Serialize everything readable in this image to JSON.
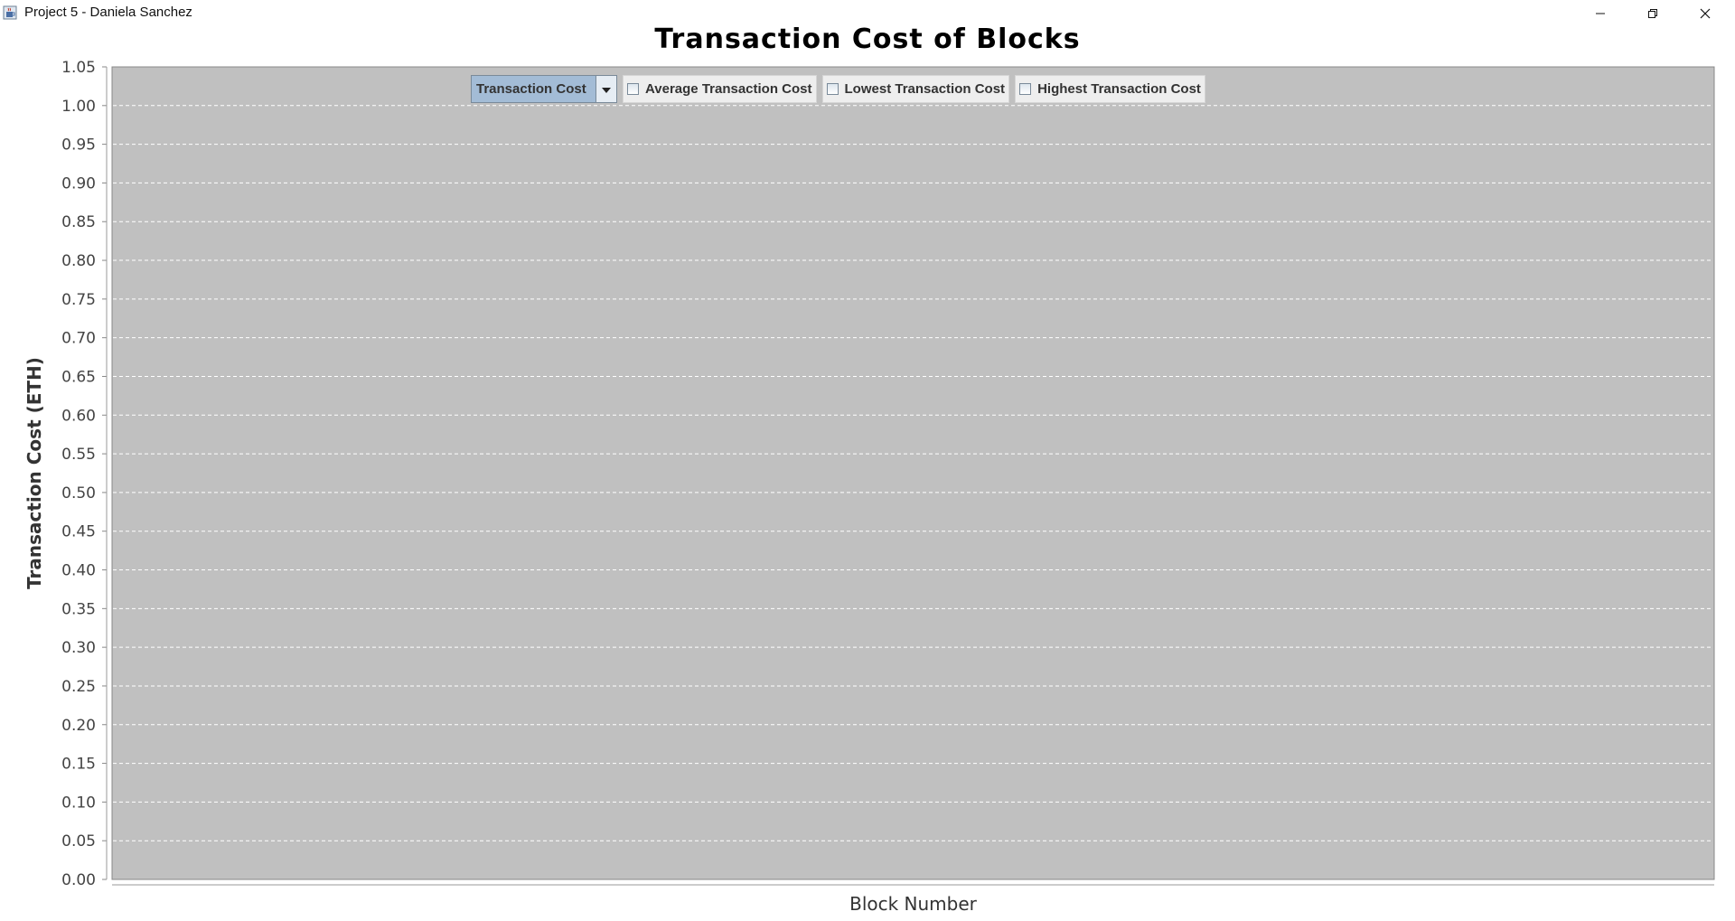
{
  "window": {
    "title": "Project 5 - Daniela Sanchez",
    "icon": "java-cup-icon",
    "controls": [
      "minimize-icon",
      "restore-icon",
      "close-icon"
    ]
  },
  "controls": {
    "series_select": {
      "selected": "Transaction Cost"
    },
    "checkboxes": [
      {
        "label": "Average Transaction Cost",
        "checked": false
      },
      {
        "label": "Lowest Transaction Cost",
        "checked": false
      },
      {
        "label": "Highest Transaction Cost",
        "checked": false
      }
    ]
  },
  "chart_data": {
    "type": "line",
    "title": "Transaction Cost of Blocks",
    "xlabel": "Block Number",
    "ylabel": "Transaction Cost (ETH)",
    "ylim": [
      0.0,
      1.05
    ],
    "yticks": [
      "0.00",
      "0.05",
      "0.10",
      "0.15",
      "0.20",
      "0.25",
      "0.30",
      "0.35",
      "0.40",
      "0.45",
      "0.50",
      "0.55",
      "0.60",
      "0.65",
      "0.70",
      "0.75",
      "0.80",
      "0.85",
      "0.90",
      "0.95",
      "1.00",
      "1.05"
    ],
    "series": [],
    "grid": true,
    "plot_background": "#c0c0c0",
    "gridline_color": "#ffffff"
  }
}
